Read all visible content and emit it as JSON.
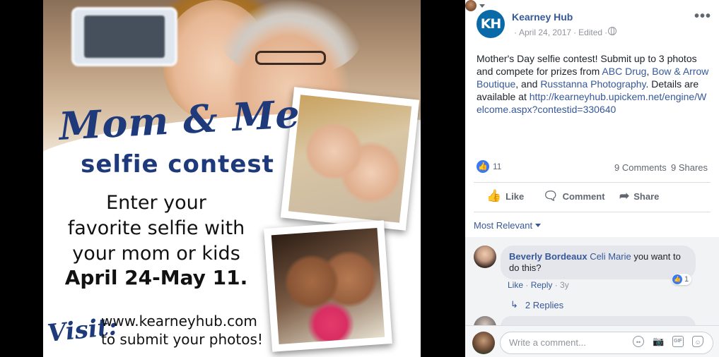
{
  "poster": {
    "title_script": "Mom & Me",
    "title_sub": "selfie contest",
    "body_lines": [
      "Enter your",
      "favorite selfie with",
      "your mom or kids"
    ],
    "dates": "April 24-May 11.",
    "visit_label": "Visit:",
    "visit_lines": [
      "www.kearneyhub.com",
      "to submit your photos!"
    ]
  },
  "post": {
    "page_avatar_text": "KH",
    "page_name": "Kearney Hub",
    "date": "April 24, 2017",
    "edited": "Edited",
    "more_icon": "more-horizontal-icon",
    "text_parts": {
      "intro": "Mother's Day selfie contest! Submit up to 3 photos and compete for prizes from ",
      "link1": "ABC Drug",
      "sep1": ", ",
      "link2": "Bow & Arrow Boutique",
      "sep2": ", and ",
      "link3": "Russtanna Photography",
      "sep3": ". Details are available at ",
      "url": "http://kearneyhub.upickem.net/engine/Welcome.aspx?contestid=330640"
    },
    "likes": "11",
    "comments_count": "9 Comments",
    "shares_count": "9 Shares"
  },
  "actions": {
    "like": "Like",
    "comment": "Comment",
    "share": "Share"
  },
  "sort": {
    "label": "Most Relevant"
  },
  "comments": [
    {
      "author": "Beverly Bordeaux",
      "tag": "Celi Marie",
      "text": " you want to do this?",
      "reactions": "1",
      "like_link": "Like",
      "reply_link": "Reply",
      "age": "3y",
      "replies": "2 Replies"
    }
  ],
  "write": {
    "placeholder": "Write a comment..."
  },
  "colors": {
    "link": "#365899",
    "brand": "#0a6aa8",
    "poster_blue": "#1f3a7a"
  }
}
